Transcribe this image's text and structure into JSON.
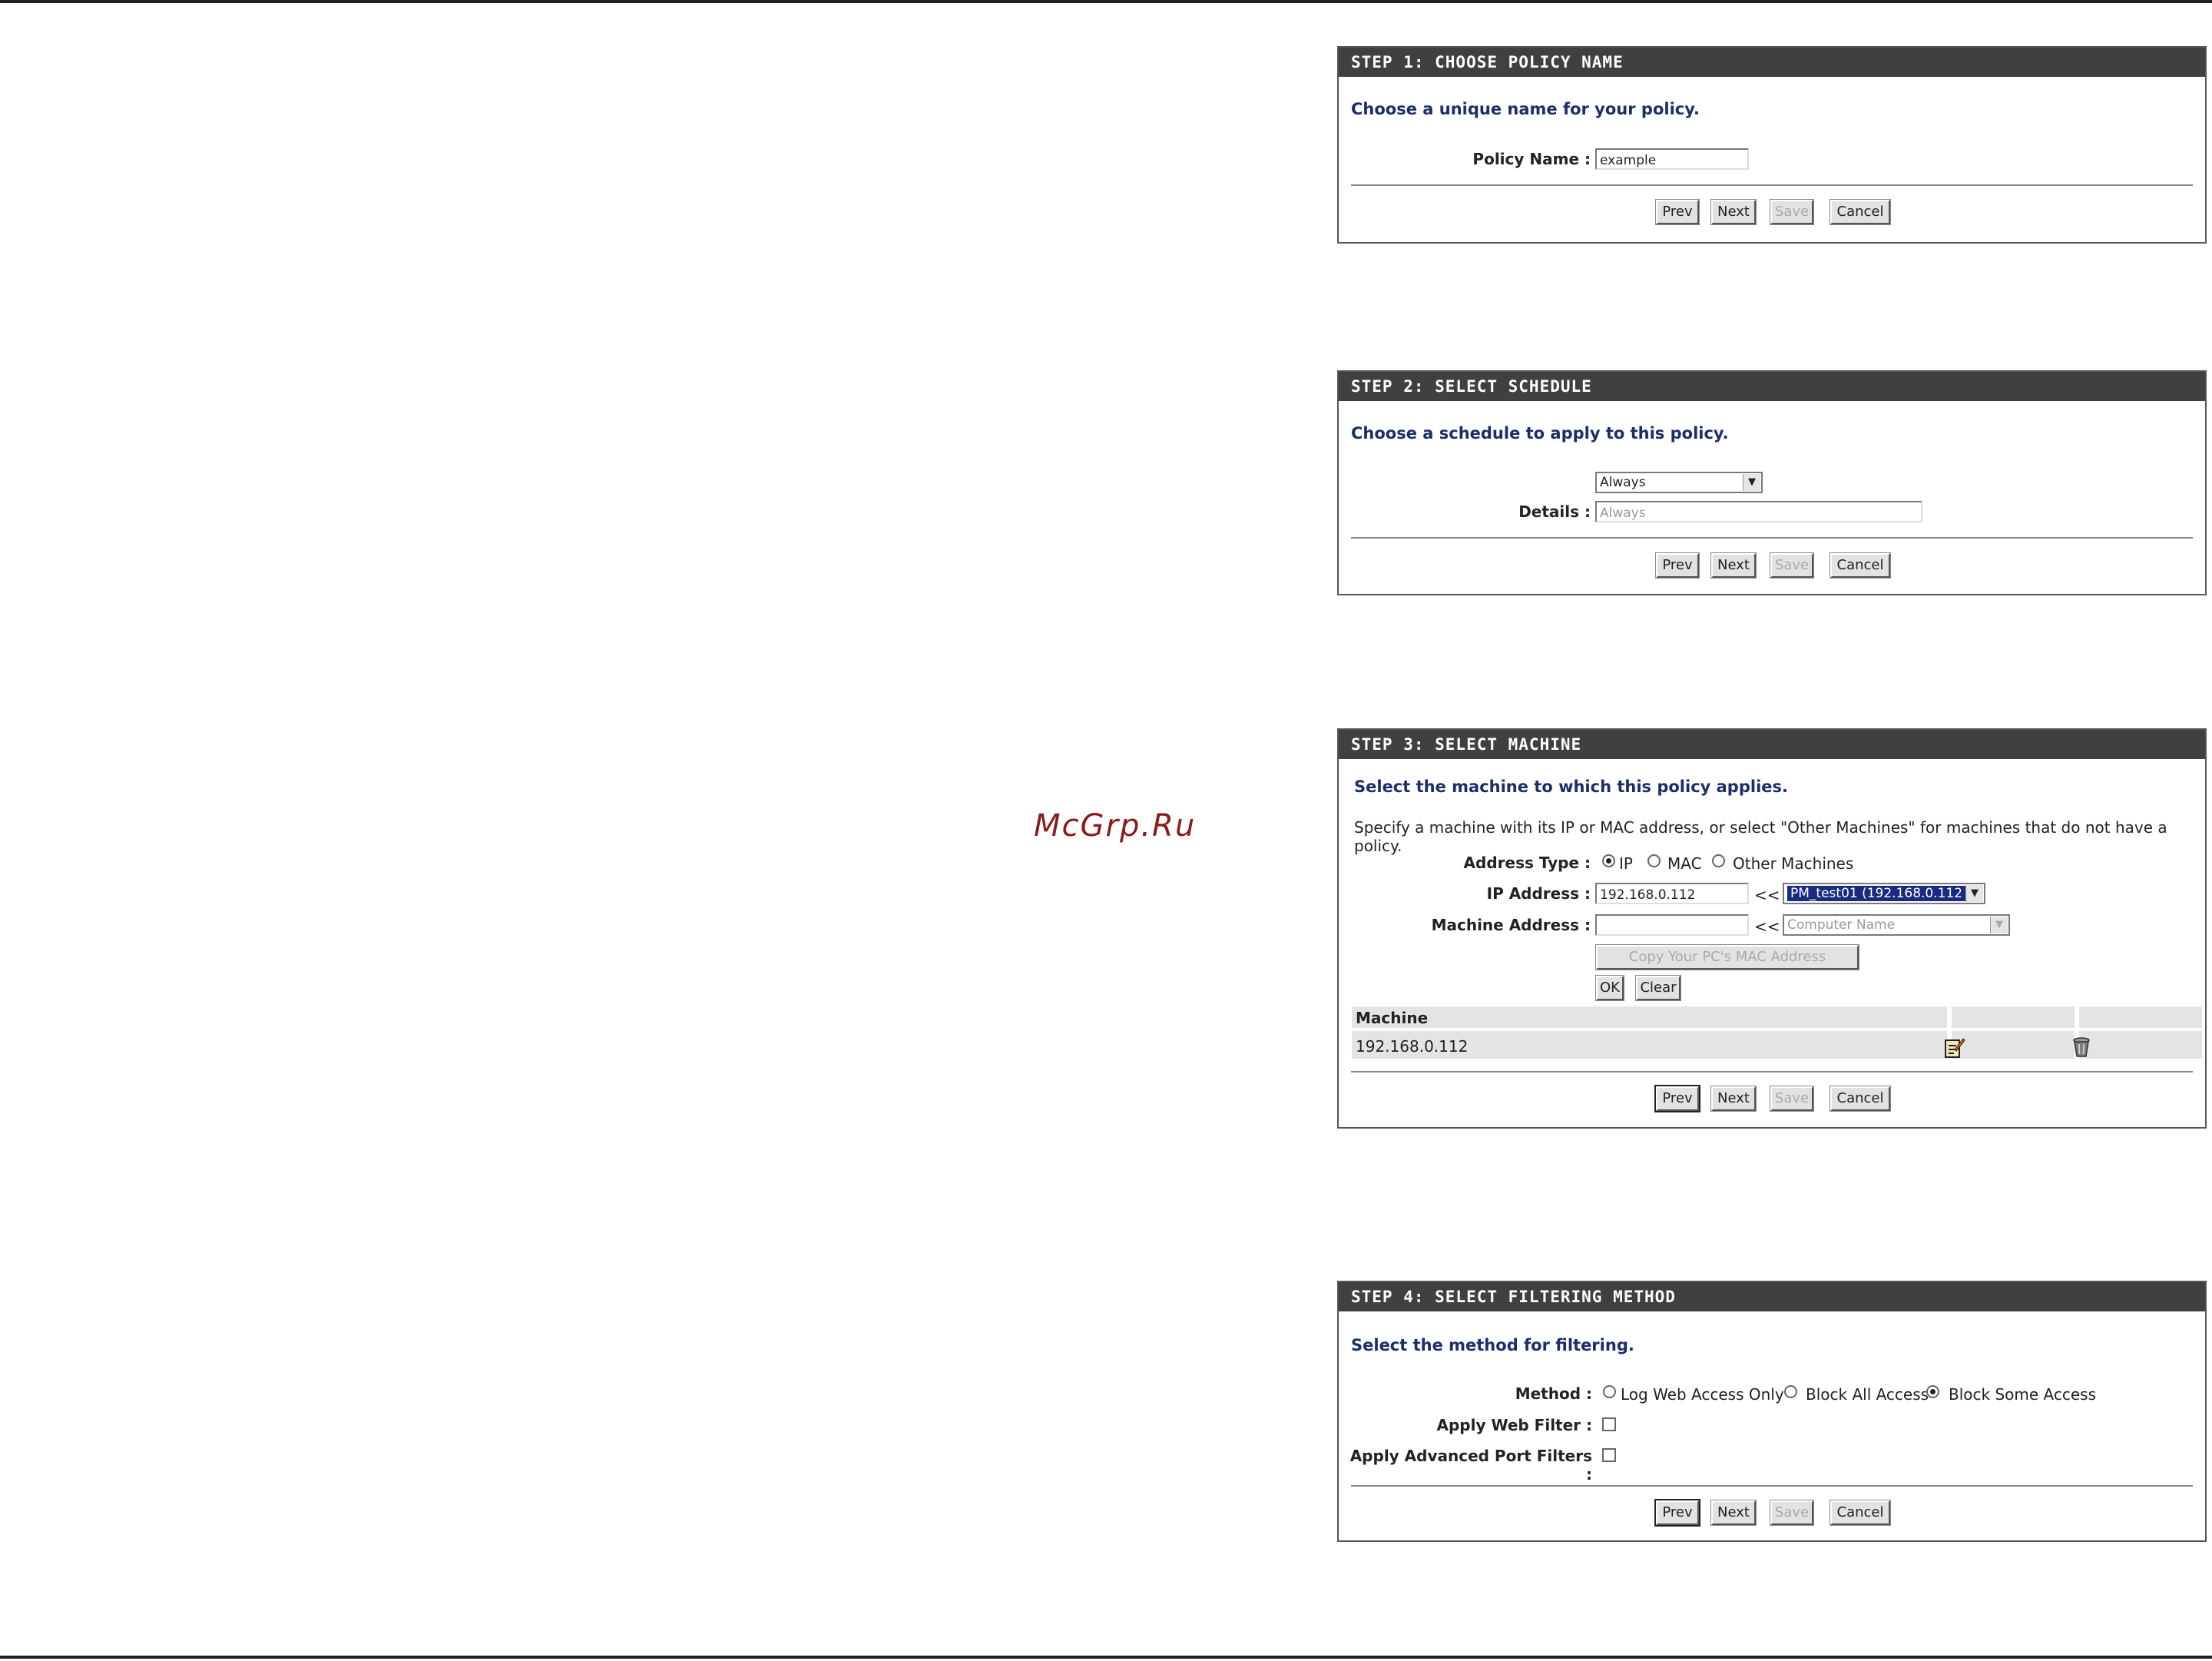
{
  "watermark": "McGrp.Ru",
  "buttons": {
    "prev": "Prev",
    "next": "Next",
    "save": "Save",
    "cancel": "Cancel"
  },
  "step1": {
    "title": "STEP 1: CHOOSE POLICY NAME",
    "intro": "Choose a unique name for your policy.",
    "policy_label": "Policy Name :",
    "policy_value": "example"
  },
  "step2": {
    "title": "STEP 2: SELECT SCHEDULE",
    "intro": "Choose a schedule to apply to this policy.",
    "schedule_value": "Always",
    "details_label": "Details :",
    "details_value": "Always"
  },
  "step3": {
    "title": "STEP 3: SELECT MACHINE",
    "intro": "Select the machine to which this policy applies.",
    "desc": "Specify a machine with its IP or MAC address, or select \"Other Machines\" for machines that do not have a policy.",
    "address_type_label": "Address Type :",
    "opt_ip": "IP",
    "opt_mac": "MAC",
    "opt_other": "Other Machines",
    "ip_label": "IP Address :",
    "ip_value": "192.168.0.112",
    "arrows": "<<",
    "ip_select_value": "PM_test01 (192.168.0.112 )",
    "mac_label": "Machine Address :",
    "mac_value": "",
    "computer_name": "Computer Name",
    "copy_mac": "Copy Your PC's MAC Address",
    "ok": "OK",
    "clear": "Clear",
    "table_header": "Machine",
    "row_value": "192.168.0.112"
  },
  "step4": {
    "title": "STEP 4: SELECT FILTERING METHOD",
    "intro": "Select the method for filtering.",
    "method_label": "Method :",
    "opt_log": "Log Web Access Only",
    "opt_block_all": "Block All Access",
    "opt_block_some": "Block Some Access",
    "web_filter_label": "Apply Web Filter :",
    "port_filter_label": "Apply Advanced Port Filters :"
  }
}
